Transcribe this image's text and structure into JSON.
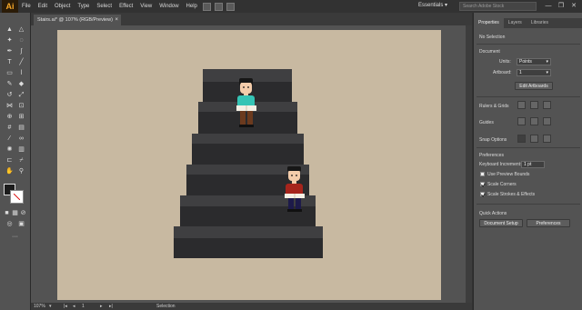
{
  "app": {
    "logo": "Ai"
  },
  "menu": [
    "File",
    "Edit",
    "Object",
    "Type",
    "Select",
    "Effect",
    "View",
    "Window",
    "Help"
  ],
  "workspace": "Essentials ▾",
  "search_placeholder": "Search Adobe Stock",
  "window_controls": [
    "—",
    "❐",
    "✕"
  ],
  "document_tab": {
    "title": "Stairs.ai* @ 107% (RGB/Preview)",
    "close": "×"
  },
  "status": {
    "zoom": "107%",
    "artboard": "1",
    "mode": "Selection"
  },
  "panel": {
    "tabs": [
      "Properties",
      "Layers",
      "Libraries"
    ],
    "no_selection": "No Selection",
    "document_heading": "Document",
    "units_label": "Units:",
    "units_value": "Points",
    "artboard_label": "Artboard:",
    "artboard_value": "1",
    "edit_artboards": "Edit Artboards",
    "rulers_grids": "Rulers & Grids",
    "guides": "Guides",
    "snap_options": "Snap Options",
    "preferences_heading": "Preferences",
    "keyboard_increment_label": "Keyboard Increment:",
    "keyboard_increment_value": "1 pt",
    "use_preview_bounds": "Use Preview Bounds",
    "scale_corners": "Scale Corners",
    "scale_strokes": "Scale Strokes & Effects",
    "quick_actions": "Quick Actions",
    "document_setup": "Document Setup",
    "preferences_btn": "Preferences"
  },
  "checkboxes": {
    "use_preview_bounds": false,
    "scale_corners": true,
    "scale_strokes": true
  },
  "colors": {
    "artboard": "#c8b9a1",
    "stair_top": "#3d3d3f",
    "stair_front": "#2a2a2c",
    "shirt_teal": "#35c4b5",
    "shirt_red": "#a6241c",
    "skin": "#f4ccaa",
    "hair": "#1a1a1a"
  }
}
